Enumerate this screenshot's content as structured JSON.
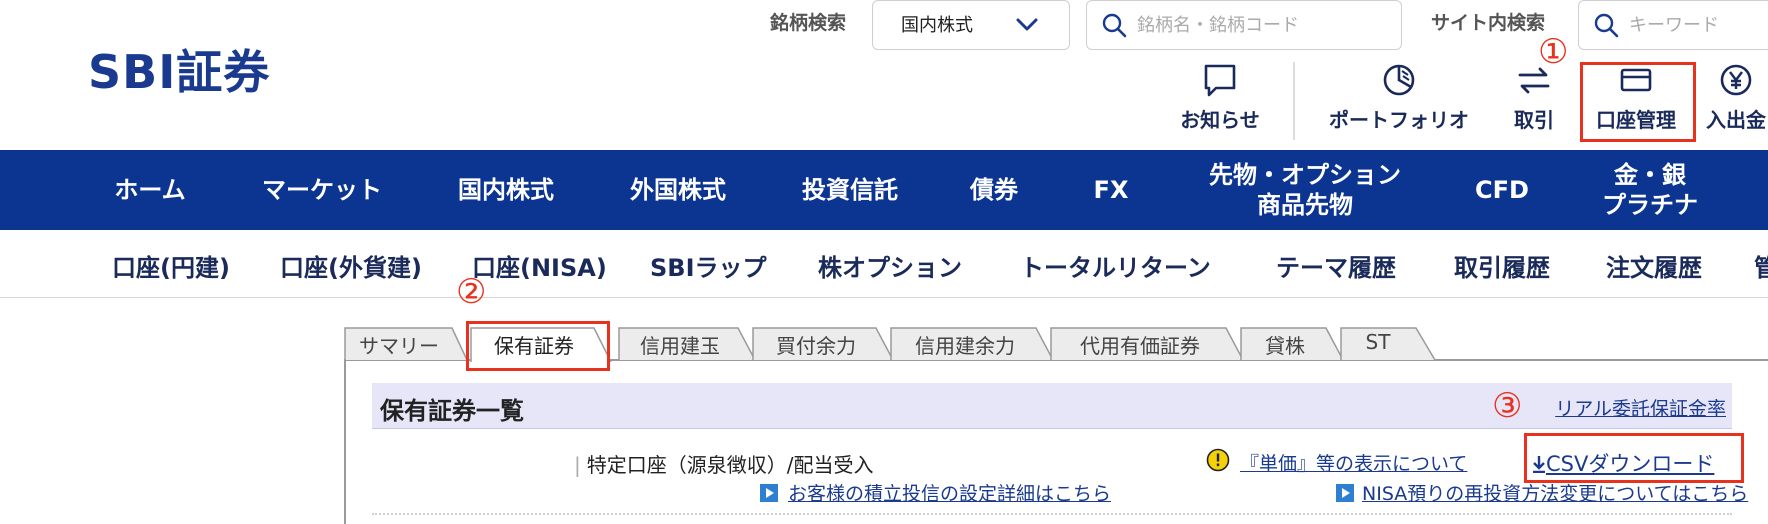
{
  "header": {
    "logo": "SBI証券",
    "symbol_search_label": "銘柄検索",
    "market_select_value": "国内株式",
    "symbol_search_placeholder": "銘柄名・銘柄コード",
    "site_search_label": "サイト内検索",
    "site_search_placeholder": "キーワード",
    "icons": [
      {
        "label": "お知らせ",
        "icon": "chat-bubble-icon"
      },
      {
        "label": "ポートフォリオ",
        "icon": "pie-chart-icon"
      },
      {
        "label": "取引",
        "icon": "exchange-arrows-icon"
      },
      {
        "label": "口座管理",
        "icon": "card-icon"
      },
      {
        "label": "入出金",
        "icon": "yen-coin-icon"
      }
    ]
  },
  "annotations": {
    "step1": "①",
    "step2": "②",
    "step3": "③",
    "highlight_color": "#e8321e"
  },
  "global_nav": [
    "ホーム",
    "マーケット",
    "国内株式",
    "外国株式",
    "投資信託",
    "債券",
    "FX",
    "先物・オプション\n商品先物",
    "CFD",
    "金・銀\nプラチナ"
  ],
  "sub_nav": [
    "口座(円建)",
    "口座(外貨建)",
    "口座(NISA)",
    "SBIラップ",
    "株オプション",
    "トータルリターン",
    "テーマ履歴",
    "取引履歴",
    "注文履歴",
    "管"
  ],
  "tabs": [
    "サマリー",
    "保有証券",
    "信用建玉",
    "買付余力",
    "信用建余力",
    "代用有価証券",
    "貸株",
    "ST"
  ],
  "holdings": {
    "title": "保有証券一覧",
    "margin_rate_link": "リアル委託保証金率",
    "account_type": "特定口座（源泉徴収）/配当受入",
    "unit_price_link": "『単価』等の表示について",
    "csv_download": "CSVダウンロード",
    "fund_settings_link": "お客様の積立投信の設定詳細はこちら",
    "nisa_link": "NISA預りの再投資方法変更についてはこちら"
  },
  "colors": {
    "brand_blue": "#0c3592",
    "link_blue": "#1a3a8f",
    "tab_header_bg": "#e6e6f8"
  }
}
